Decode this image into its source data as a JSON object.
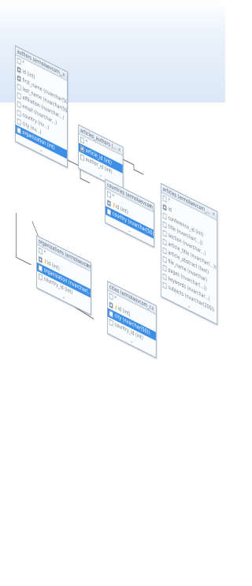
{
  "tables": [
    {
      "id": "authors",
      "title": "authors (ermolaevcom_...",
      "close": "×",
      "columns": [
        {
          "text": "*",
          "checked": false
        },
        {
          "text": "id (int)",
          "checked": true
        },
        {
          "text": "first_name (nvarchar(50))",
          "checked": true
        },
        {
          "text": "last_name (nvarchar(50))",
          "checked": false
        },
        {
          "text": "affiliation (nvarchar...)",
          "checked": false
        },
        {
          "text": "email (nvarchar...)",
          "checked": false
        },
        {
          "text": "country (nv...)",
          "checked": false
        },
        {
          "text": "city (nv...)",
          "checked": false
        },
        {
          "text": "organization (int)",
          "checked": false,
          "selected": true
        }
      ],
      "footer": "⌄"
    },
    {
      "id": "articles_authors",
      "title": "articles_authors (...",
      "close": "×",
      "columns": [
        {
          "text": "*",
          "checked": false
        },
        {
          "text": "article_id (int)",
          "checked": true,
          "selected": true
        },
        {
          "text": "author_id (int)",
          "checked": false
        }
      ],
      "footer": "⌄"
    },
    {
      "id": "articles",
      "title": "articles (ermolaevcom_...",
      "close": "×",
      "columns": [
        {
          "text": "*",
          "checked": false
        },
        {
          "text": "id",
          "checked": true
        },
        {
          "text": "conference_id (int)",
          "checked": false
        },
        {
          "text": "title (nvarchar(...))",
          "checked": false
        },
        {
          "text": "section (nvarchar...)",
          "checked": false
        },
        {
          "text": "article_title (nvarchar(...))",
          "checked": false
        },
        {
          "text": "article_abstract (text)",
          "checked": false
        },
        {
          "text": "file_name (nvarchar)",
          "checked": false
        },
        {
          "text": "pages (nvarchar(...))",
          "checked": false
        },
        {
          "text": "keywords (nvarchar...)",
          "checked": false
        },
        {
          "text": "subjects (nvarchar(200))",
          "checked": false
        }
      ],
      "footer": "⌄"
    },
    {
      "id": "countries",
      "title": "countries (ermolaevcom_...",
      "close": "×",
      "columns": [
        {
          "text": "*",
          "checked": false
        },
        {
          "text": "id (int)",
          "checked": true,
          "key": true
        },
        {
          "text": "country (nvarchar(50))",
          "checked": false,
          "selected": true
        }
      ],
      "footer": "⌄"
    },
    {
      "id": "organizations",
      "title": "organizations (ermolaevcom_r...",
      "close": "×",
      "columns": [
        {
          "text": "*",
          "checked": false
        },
        {
          "text": "id (int)",
          "checked": true,
          "key": true
        },
        {
          "text": "organization (nvarchar(...))",
          "checked": false,
          "selected": true
        },
        {
          "text": "country_id (int)",
          "checked": false
        }
      ],
      "footer": "⌄"
    },
    {
      "id": "cities",
      "title": "cities (ermolaevcom_r...",
      "close": "×",
      "columns": [
        {
          "text": "*",
          "checked": false
        },
        {
          "text": "id (int)",
          "checked": true,
          "key": true
        },
        {
          "text": "city (nvarchar(50))",
          "checked": false,
          "selected": true
        },
        {
          "text": "country_id (int)",
          "checked": false
        }
      ],
      "footer": "⌄"
    }
  ],
  "colors": {
    "accent": "#3d8fe6",
    "line": "#5b5b5b",
    "band": "#dbe8f7"
  },
  "icons": {
    "key": "key-icon",
    "checkbox": "checkbox-icon"
  }
}
